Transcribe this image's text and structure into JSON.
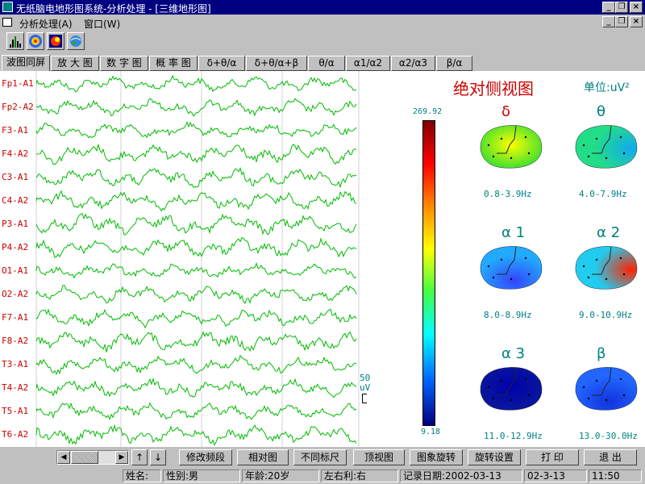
{
  "window": {
    "title": "无纸脑电地形图系统-分析处理 - [三维地形图]"
  },
  "menu": {
    "analysis": "分析处理(A)",
    "window": "窗口(W)"
  },
  "tabs": [
    "波图同屏",
    "放 大 图",
    "数 字 图",
    "概 率 图",
    "δ+θ/α",
    "δ+θ/α+β",
    "θ/α",
    "α1/α2",
    "α2/α3",
    "β/α"
  ],
  "channels": [
    "Fp1-A1",
    "Fp2-A2",
    "F3-A1",
    "F4-A2",
    "C3-A1",
    "C4-A2",
    "P3-A1",
    "P4-A2",
    "O1-A1",
    "O2-A2",
    "F7-A1",
    "F8-A2",
    "T3-A1",
    "T4-A2",
    "T5-A1",
    "T6-A2"
  ],
  "scale": {
    "value": "50",
    "unit": "uV"
  },
  "topo": {
    "title": "绝对侧视图",
    "unit": "单位:uV²",
    "colorbar": {
      "max": "269.92",
      "min": "9.18"
    },
    "maps": [
      {
        "symbol": "δ",
        "range": "0.8-3.9Hz",
        "base": "#33dd33",
        "hot": "#ffff00",
        "hot_pos": "mid"
      },
      {
        "symbol": "θ",
        "range": "4.0-7.9Hz",
        "base": "#22dd88",
        "hot": "#11aaee",
        "hot_pos": "right"
      },
      {
        "symbol": "α 1",
        "range": "8.0-8.9Hz",
        "base": "#22aaff",
        "hot": "#3344ff",
        "hot_pos": "bottom"
      },
      {
        "symbol": "α 2",
        "range": "9.0-10.9Hz",
        "base": "#22ccee",
        "hot": "#ff2200",
        "hot_pos": "right"
      },
      {
        "symbol": "α 3",
        "range": "11.0-12.9Hz",
        "base": "#0a1a9a",
        "hot": "#0000aa",
        "hot_pos": "mid"
      },
      {
        "symbol": "β",
        "range": "13.0-30.0Hz",
        "base": "#2266ff",
        "hot": "#1133dd",
        "hot_pos": "bottom"
      }
    ]
  },
  "controls": {
    "up": "↑",
    "down": "↓",
    "modify_freq": "修改频段",
    "relative": "相对图",
    "diff_scale": "不同标尺",
    "top_view": "顶视图",
    "rotate_image": "图象旋转",
    "rotate_settings": "旋转设置",
    "print": "打 印",
    "exit": "退 出"
  },
  "status": {
    "name": "姓名:",
    "sex": "性别:男",
    "age": "年龄:20岁",
    "handed": "左右利:右",
    "record_date": "记录日期:2002-03-13",
    "date": "02-3-13",
    "time": "11:50"
  },
  "colors": {
    "wave": "#00bb00",
    "label": "#cc0000",
    "title": "#cc0000",
    "teal": "#008080",
    "titlebar": "#000080"
  }
}
